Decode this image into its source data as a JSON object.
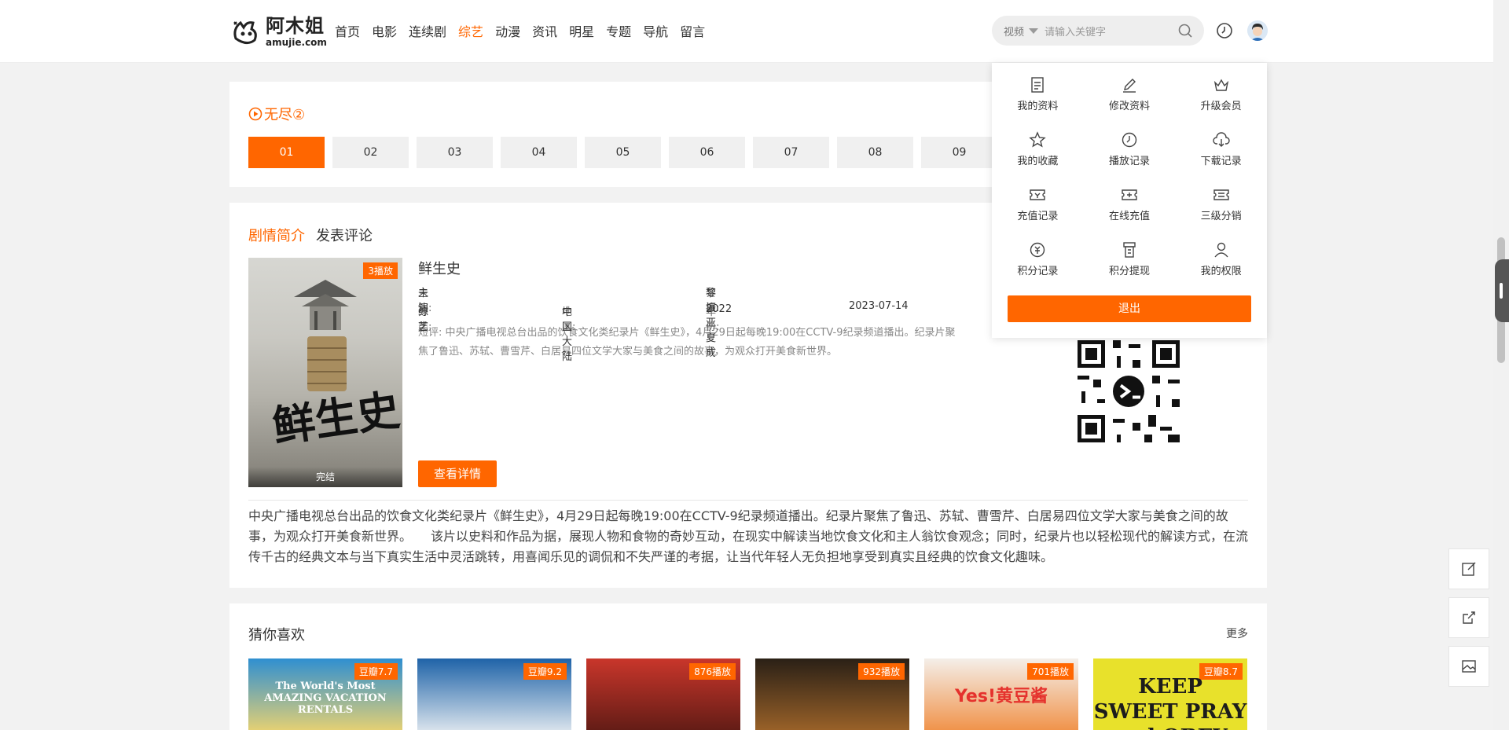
{
  "header": {
    "logo_cn": "阿木姐",
    "logo_en": "amujie.com",
    "nav": [
      "首页",
      "电影",
      "连续剧",
      "综艺",
      "动漫",
      "资讯",
      "明星",
      "专题",
      "导航",
      "留言"
    ],
    "nav_active": "综艺",
    "search_category": "视频",
    "search_placeholder": "请输入关键字"
  },
  "episodes": {
    "title": "无尽②",
    "list": [
      "01",
      "02",
      "03",
      "04",
      "05",
      "06",
      "07",
      "08",
      "09"
    ],
    "active": "01"
  },
  "info": {
    "tabs": [
      "剧情简介",
      "发表评论"
    ],
    "poster_badge": "3播放",
    "poster_status": "完结",
    "poster_calligraphy": "鲜生史",
    "name": "鲜生史",
    "actor_label": "主演:",
    "actor_value": "未知",
    "director_label": "导演:",
    "director_value": "黎振亚 夏成",
    "category_label": "分类:",
    "category_value": "综艺",
    "area_label": "地区:",
    "area_value": "中国大陆",
    "year_label": "年份:",
    "year_value": "2022",
    "date": "2023-07-14",
    "brief_label": "短评:",
    "brief_line1": "中央广播电视总台出品的饮食文化类纪录片《鲜生史》，4月29日起每晚19:00在CCTV-9纪录频道播出。纪录片聚",
    "brief_line2": "焦了鲁迅、苏轼、曹雪芹、白居易四位文学大家与美食之间的故事，为观众打开美食新世界。",
    "detail_button": "查看详情",
    "description": "中央广播电视总台出品的饮食文化类纪录片《鲜生史》，4月29日起每晚19:00在CCTV-9纪录频道播出。纪录片聚焦了鲁迅、苏轼、曹雪芹、白居易四位文学大家与美食之间的故事，为观众打开美食新世界。　　该片以史料和作品为据，展现人物和食物的奇妙互动，在现实中解读当地饮食文化和主人翁饮食观念；同时，纪录片也以轻松现代的解读方式，在流传千古的经典文本与当下真实生活中灵活跳转，用喜闻乐见的调侃和不失严谨的考据，让当代年轻人无负担地享受到真实且经典的饮食文化趣味。"
  },
  "recommend": {
    "title": "猜你喜欢",
    "more": "更多",
    "cards": [
      {
        "badge": "豆瓣7.7",
        "text": "The World's Most AMAZING VACATION RENTALS",
        "colors": [
          "#2f8fd1",
          "#f5d66b"
        ]
      },
      {
        "badge": "豆瓣9.2",
        "text": "",
        "colors": [
          "#1f63a8",
          "#e9eef2"
        ]
      },
      {
        "badge": "876播放",
        "text": "",
        "colors": [
          "#c9362b",
          "#5a1a14"
        ]
      },
      {
        "badge": "932播放",
        "text": "",
        "colors": [
          "#2a2016",
          "#a3672a"
        ]
      },
      {
        "badge": "701播放",
        "text": "Yes!黄豆酱",
        "colors": [
          "#f4efe9",
          "#f08b3c"
        ]
      },
      {
        "badge": "豆瓣8.7",
        "text": "KEEP SWEET PRAY and OBEY",
        "colors": [
          "#e8e12b",
          "#e8e12b"
        ]
      }
    ]
  },
  "user_menu": {
    "items": [
      {
        "label": "我的资料",
        "icon": "profile-icon"
      },
      {
        "label": "修改资料",
        "icon": "edit-icon"
      },
      {
        "label": "升级会员",
        "icon": "crown-icon"
      },
      {
        "label": "我的收藏",
        "icon": "star-icon"
      },
      {
        "label": "播放记录",
        "icon": "clock-icon"
      },
      {
        "label": "下载记录",
        "icon": "cloud-download-icon"
      },
      {
        "label": "充值记录",
        "icon": "ticket-icon"
      },
      {
        "label": "在线充值",
        "icon": "ticket-plus-icon"
      },
      {
        "label": "三级分销",
        "icon": "ticket-list-icon"
      },
      {
        "label": "积分记录",
        "icon": "coin-icon"
      },
      {
        "label": "积分提现",
        "icon": "withdraw-icon"
      },
      {
        "label": "我的权限",
        "icon": "user-icon"
      }
    ],
    "logout": "退出"
  },
  "colors": {
    "accent": "#ff6600"
  }
}
